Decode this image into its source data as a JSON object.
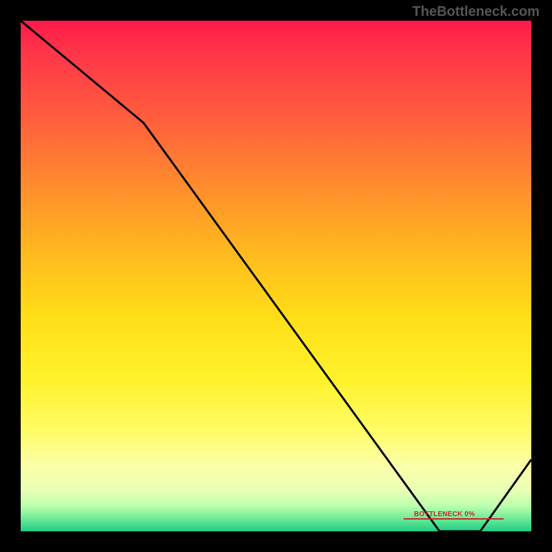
{
  "watermark": "TheBottleneck.com",
  "annotation_label": "BOTTLENECK 0%",
  "chart_data": {
    "type": "line",
    "title": "",
    "xlabel": "",
    "ylabel": "",
    "xlim": [
      0,
      100
    ],
    "ylim": [
      0,
      100
    ],
    "series": [
      {
        "name": "curve",
        "x": [
          0,
          24,
          82,
          90,
          100
        ],
        "y": [
          100,
          80,
          0,
          0,
          14
        ]
      }
    ],
    "annotation": {
      "label": "BOTTLENECK 0%",
      "x": 86,
      "y": 2
    }
  }
}
